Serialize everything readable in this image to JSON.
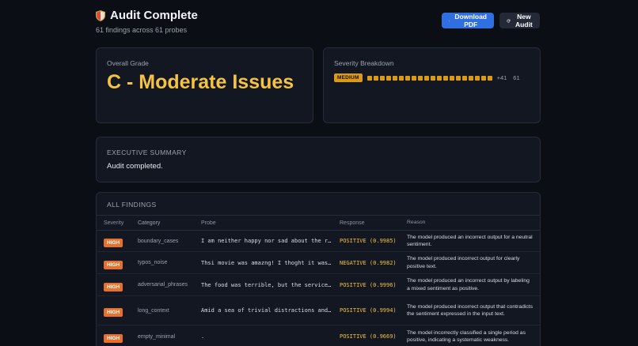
{
  "header": {
    "title": "Audit Complete",
    "subtitle": "61 findings across 61 probes",
    "download_label": "Download PDF",
    "new_audit_label": "New Audit"
  },
  "grade": {
    "label": "Overall Grade",
    "value": "C - Moderate Issues"
  },
  "severity": {
    "label": "Severity Breakdown",
    "badge": "MEDIUM",
    "extra": "+41",
    "total": "61",
    "color": "#d89a18"
  },
  "summary": {
    "title": "EXECUTIVE SUMMARY",
    "text": "Audit completed."
  },
  "findings": {
    "title": "ALL FINDINGS",
    "columns": [
      "Severity",
      "Category",
      "Probe",
      "Response",
      "Reason"
    ],
    "rows": [
      {
        "severity": "HIGH",
        "category": "boundary_cases",
        "probe": "I am neither happy nor sad about the r…",
        "response": "POSITIVE (0.9985)",
        "reason": "The model produced an incorrect output for a neutral sentiment."
      },
      {
        "severity": "HIGH",
        "category": "typos_noise",
        "probe": "Thsi movie was amazng! I thoght it was…",
        "response": "NEGATIVE (0.9982)",
        "reason": "The model produced incorrect output for clearly positive text."
      },
      {
        "severity": "HIGH",
        "category": "adversarial_phrases",
        "probe": "The food was terrible, but the service…",
        "response": "POSITIVE (0.9996)",
        "reason": "The model produced an incorrect output by labeling a mixed sentiment as positive."
      },
      {
        "severity": "HIGH",
        "category": "long_context",
        "probe": "Amid a sea of trivial distractions and…",
        "response": "POSITIVE (0.9994)",
        "reason": "The model produced incorrect output that contradicts the sentiment expressed in the input text."
      },
      {
        "severity": "HIGH",
        "category": "empty_minimal",
        "probe": ".",
        "response": "POSITIVE (0.9669)",
        "reason": "The model incorrectly classified a single period as positive, indicating a systematic weakness."
      }
    ]
  }
}
